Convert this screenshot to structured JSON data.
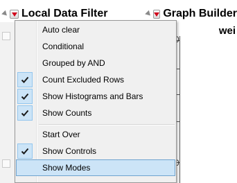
{
  "local_data_filter": {
    "title": "Local Data Filter"
  },
  "graph_builder": {
    "title": "Graph Builder",
    "subtitle": "wei",
    "axis_zero": "0"
  },
  "menu": {
    "items": [
      {
        "label": "Auto clear",
        "checked": false
      },
      {
        "label": "Conditional",
        "checked": false
      },
      {
        "label": "Grouped by AND",
        "checked": false
      },
      {
        "label": "Count Excluded Rows",
        "checked": true
      },
      {
        "label": "Show Histograms and Bars",
        "checked": true
      },
      {
        "label": "Show Counts",
        "checked": true
      },
      {
        "label": "Start Over",
        "checked": false
      },
      {
        "label": "Show Controls",
        "checked": true
      },
      {
        "label": "Show Modes",
        "checked": false,
        "highlighted": true
      }
    ]
  },
  "colors": {
    "menu_bg": "#f0f0f0",
    "highlight_bg": "#cce4f7",
    "highlight_border": "#6ea3cf",
    "check_color": "#1a1a1a",
    "red_triangle": "#d0021b"
  }
}
